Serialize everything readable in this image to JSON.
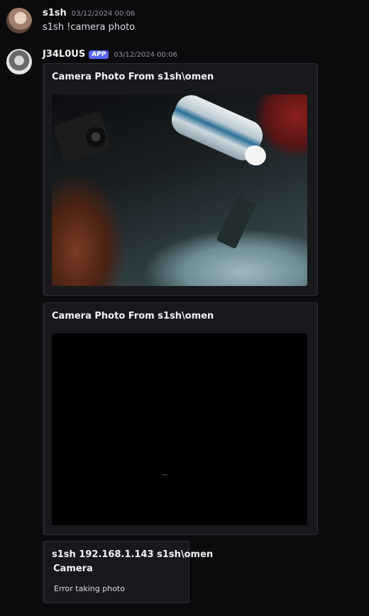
{
  "message1": {
    "username": "s1sh",
    "timestamp": "03/12/2024 00:06",
    "text": "s1sh !camera photo"
  },
  "message2": {
    "username": "J34L0US",
    "badge": "APP",
    "timestamp": "03/12/2024 00:06",
    "embeds": [
      {
        "title": "Camera Photo From s1sh\\omen"
      },
      {
        "title": "Camera Photo From s1sh\\omen"
      },
      {
        "title": "s1sh 192.168.1.143 s1sh\\omen",
        "subtitle": "Camera",
        "description": "Error taking photo"
      }
    ]
  },
  "colors": {
    "background": "#0b0b0d",
    "embed_bg": "#18191c",
    "badge": "#5865f2"
  }
}
